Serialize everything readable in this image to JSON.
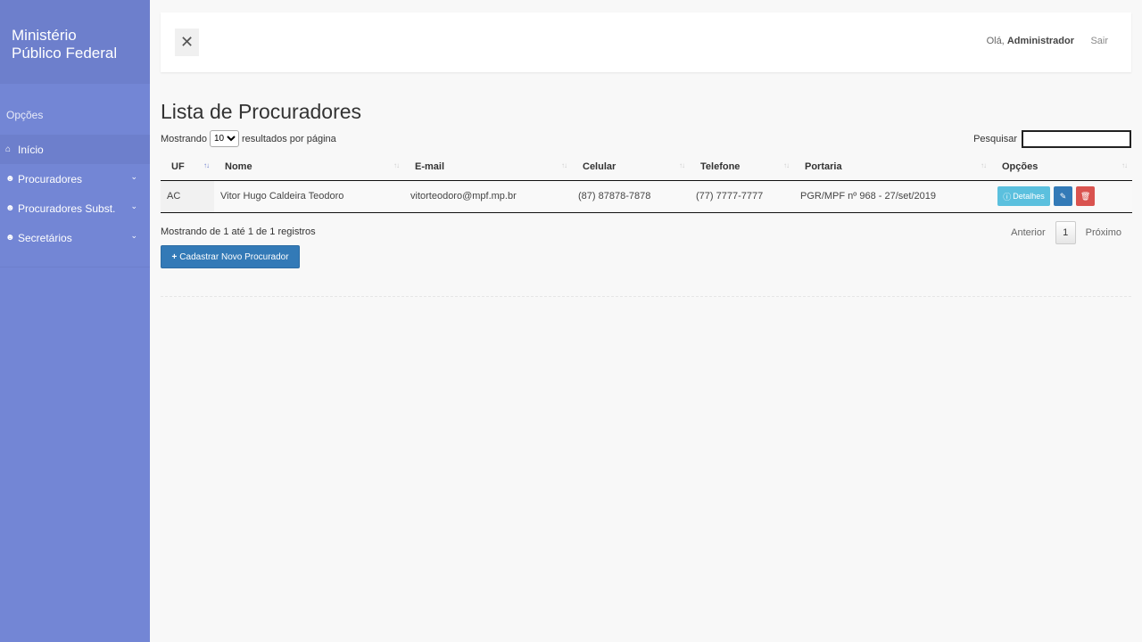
{
  "sidebar": {
    "brand_line1": "Ministério",
    "brand_line2": "Público Federal",
    "section_label": "Opções",
    "items": [
      {
        "label": "Início",
        "icon": "home-icon",
        "active": true
      },
      {
        "label": "Procuradores",
        "icon": "users-icon",
        "has_submenu": true
      },
      {
        "label": "Procuradores Subst.",
        "icon": "users-icon",
        "has_submenu": true
      },
      {
        "label": "Secretários",
        "icon": "users-icon",
        "has_submenu": true
      }
    ]
  },
  "topbar": {
    "toggle_icon": "close-icon",
    "greeting_prefix": "Olá,",
    "user_name": "Administrador",
    "logout_label": "Sair"
  },
  "main": {
    "title": "Lista de Procuradores",
    "length_prefix": "Mostrando",
    "length_value": "10",
    "length_suffix": "resultados por página",
    "search_label": "Pesquisar",
    "search_value": "",
    "columns": [
      "UF",
      "Nome",
      "E-mail",
      "Celular",
      "Telefone",
      "Portaria",
      "Opções"
    ],
    "rows": [
      {
        "uf": "AC",
        "nome": "Vitor Hugo Caldeira Teodoro",
        "email": "vitorteodoro@mpf.mp.br",
        "celular": "(87) 87878-7878",
        "telefone": "(77) 7777-7777",
        "portaria": "PGR/MPF nº 968 - 27/set/2019",
        "details_label": "Detalhes"
      }
    ],
    "info_text": "Mostrando de 1 até 1 de 1 registros",
    "pager_prev": "Anterior",
    "pager_current": "1",
    "pager_next": "Próximo",
    "add_button": "Cadastrar Novo Procurador"
  },
  "colors": {
    "sidebar_bg": "#7386d5",
    "sidebar_header_bg": "#6d7fcc",
    "primary": "#337ab7",
    "info": "#5bc0de",
    "danger": "#d9534f"
  }
}
